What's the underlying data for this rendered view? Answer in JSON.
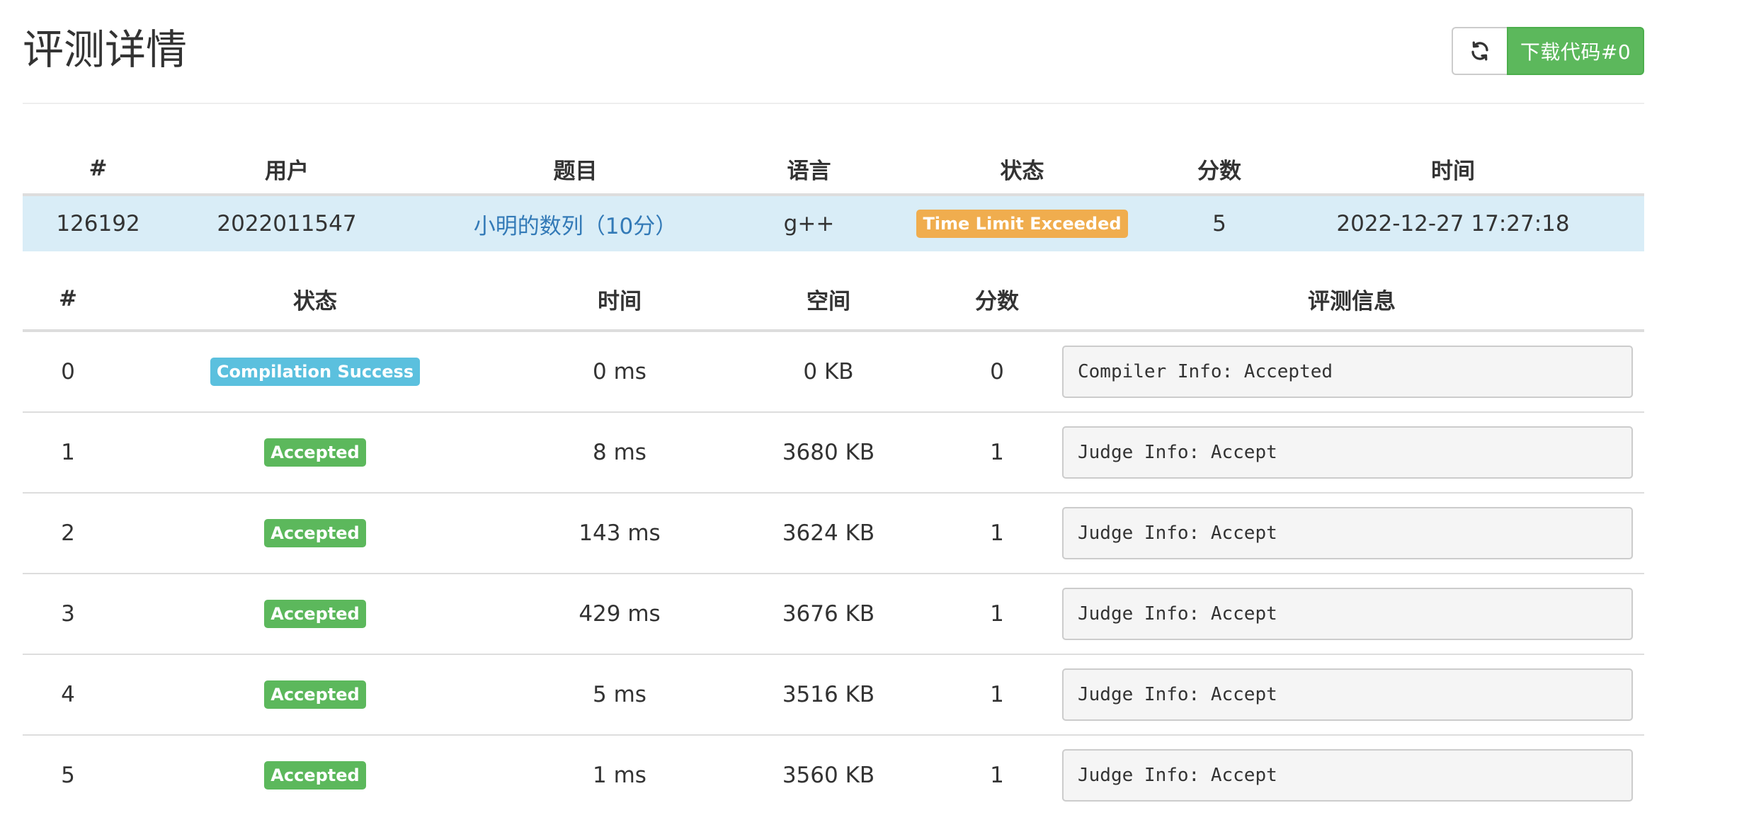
{
  "page": {
    "title": "评测详情"
  },
  "toolbar": {
    "refresh_icon": "refresh-icon",
    "download_label": "下载代码#0"
  },
  "summary": {
    "headers": [
      "#",
      "用户",
      "题目",
      "语言",
      "状态",
      "分数",
      "时间"
    ],
    "row": {
      "id": "126192",
      "user": "2022011547",
      "problem": "小明的数列（10分）",
      "language": "g++",
      "status": "Time Limit Exceeded",
      "score": "5",
      "time": "2022-12-27 17:27:18"
    }
  },
  "tests": {
    "headers": [
      "#",
      "状态",
      "时间",
      "空间",
      "分数",
      "评测信息"
    ],
    "rows": [
      {
        "index": "0",
        "status": "Compilation Success",
        "time": "0 ms",
        "memory": "0 KB",
        "score": "0",
        "info": "Compiler Info: Accepted"
      },
      {
        "index": "1",
        "status": "Accepted",
        "time": "8 ms",
        "memory": "3680 KB",
        "score": "1",
        "info": "Judge Info: Accept"
      },
      {
        "index": "2",
        "status": "Accepted",
        "time": "143 ms",
        "memory": "3624 KB",
        "score": "1",
        "info": "Judge Info: Accept"
      },
      {
        "index": "3",
        "status": "Accepted",
        "time": "429 ms",
        "memory": "3676 KB",
        "score": "1",
        "info": "Judge Info: Accept"
      },
      {
        "index": "4",
        "status": "Accepted",
        "time": "5 ms",
        "memory": "3516 KB",
        "score": "1",
        "info": "Judge Info: Accept"
      },
      {
        "index": "5",
        "status": "Accepted",
        "time": "1 ms",
        "memory": "3560 KB",
        "score": "1",
        "info": "Judge Info: Accept"
      }
    ]
  },
  "colors": {
    "success": "#5cb85c",
    "info": "#5bc0de",
    "warning": "#f0ad4e",
    "link": "#337ab7",
    "summary_row_bg": "#d9edf7"
  }
}
